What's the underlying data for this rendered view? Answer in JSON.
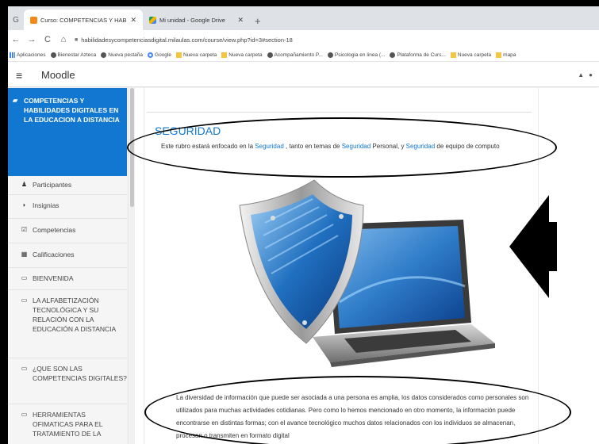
{
  "browser": {
    "tabs": [
      {
        "title": "Curso: COMPETENCIAS Y HABILI",
        "active": true
      },
      {
        "title": "Mi unidad - Google Drive",
        "active": false
      }
    ],
    "close_glyph": "✕",
    "newtab_glyph": "+",
    "url": "habilidadesycompetenciasdigital.milaulas.com/course/view.php?id=3#section-18",
    "bookmarks": [
      {
        "label": "Aplicaciones",
        "icon": "grid-icon"
      },
      {
        "label": "Bienestar Azteca",
        "icon": "globe-icon"
      },
      {
        "label": "Nueva pestaña",
        "icon": "globe-icon"
      },
      {
        "label": "Google",
        "icon": "google-icon"
      },
      {
        "label": "Nueva carpeta",
        "icon": "folder-icon"
      },
      {
        "label": "Nueva carpeta",
        "icon": "folder-icon"
      },
      {
        "label": "Acompañamiento P...",
        "icon": "globe-icon"
      },
      {
        "label": "Psicologia en linea (...",
        "icon": "globe-icon"
      },
      {
        "label": "Plataforma de Curs...",
        "icon": "globe-icon"
      },
      {
        "label": "Nueva carpeta",
        "icon": "folder-icon"
      },
      {
        "label": "mapa",
        "icon": "folder-icon"
      }
    ]
  },
  "moodle": {
    "brand": "Moodle",
    "course_title": "COMPETENCIAS Y HABILIDADES DIGITALES EN LA EDUCACION A DISTANCIA",
    "nav": [
      {
        "label": "Participantes",
        "icon": "users-icon"
      },
      {
        "label": "Insignias",
        "icon": "shield-badge-icon"
      },
      {
        "label": "Competencias",
        "icon": "checkbox-icon"
      },
      {
        "label": "Calificaciones",
        "icon": "table-icon"
      },
      {
        "label": "BIENVENIDA",
        "icon": "folder-icon"
      },
      {
        "label": "LA ALFABETIZACIÓN TECNOLÓGICA Y SU RELACIÓN CON LA EDUCACIÓN A DISTANCIA",
        "icon": "folder-icon"
      },
      {
        "label": "¿QUE SON LAS COMPETENCIAS DIGITALES?",
        "icon": "folder-icon"
      },
      {
        "label": "HERRAMIENTAS OFIMATICAS PARA EL TRATAMIENTO DE LA",
        "icon": "folder-icon"
      }
    ]
  },
  "section": {
    "title": "SEGURIDAD",
    "desc_1": "Este  rubro estará enfocado en la ",
    "desc_link_1": "Seguridad",
    "desc_2": " , tanto en temas de ",
    "desc_link_2": "Seguridad",
    "desc_3": " Personal, y ",
    "desc_link_3": "Seguridad",
    "desc_4": " de  equipo de computo",
    "body": "La diversidad de información que puede ser asociada a una persona es amplia, los datos considerados como personales son utilizados para muchas actividades cotidianas. Pero como lo hemos mencionado en otro momento, la información puede encontrarse en distintas formas; con el avance tecnológico muchos datos relacionados con los individuos se almacenan, procesan o transmiten en formato digital"
  },
  "colors": {
    "accent": "#1177d1",
    "frame": "#000000"
  }
}
